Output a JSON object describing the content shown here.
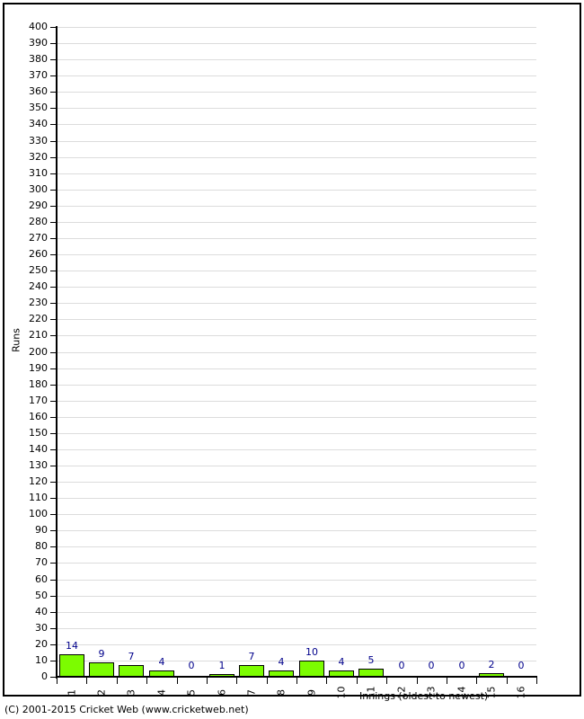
{
  "footer": {
    "copyright": "(C) 2001-2015 Cricket Web (www.cricketweb.net)"
  },
  "chart_data": {
    "type": "bar",
    "title": "",
    "xlabel": "Innings (oldest to newest)",
    "ylabel": "Runs",
    "categories": [
      "1",
      "2",
      "3",
      "4",
      "5",
      "6",
      "7",
      "8",
      "9",
      "10",
      "11",
      "12",
      "13",
      "14",
      "15",
      "16"
    ],
    "values": [
      14,
      9,
      7,
      4,
      0,
      1,
      7,
      4,
      10,
      4,
      5,
      0,
      0,
      0,
      2,
      0
    ],
    "value_labels": [
      "14",
      "9",
      "7",
      "4",
      "0",
      "1",
      "7",
      "4",
      "10",
      "4",
      "5",
      "0",
      "0",
      "0",
      "2",
      "0"
    ],
    "ylim": [
      0,
      400
    ],
    "ytick_step": 10,
    "yticks": [
      "0",
      "10",
      "20",
      "30",
      "40",
      "50",
      "60",
      "70",
      "80",
      "90",
      "100",
      "110",
      "120",
      "130",
      "140",
      "150",
      "160",
      "170",
      "180",
      "190",
      "200",
      "210",
      "220",
      "230",
      "240",
      "250",
      "260",
      "270",
      "280",
      "290",
      "300",
      "310",
      "320",
      "330",
      "340",
      "350",
      "360",
      "370",
      "380",
      "390",
      "400"
    ],
    "grid": true,
    "legend": "none",
    "bar_color": "#7CFC00",
    "bar_border_color": "#000000",
    "value_label_color": "#00008B",
    "gridline_color": "#DCDCDC",
    "axis_color": "#000000"
  }
}
